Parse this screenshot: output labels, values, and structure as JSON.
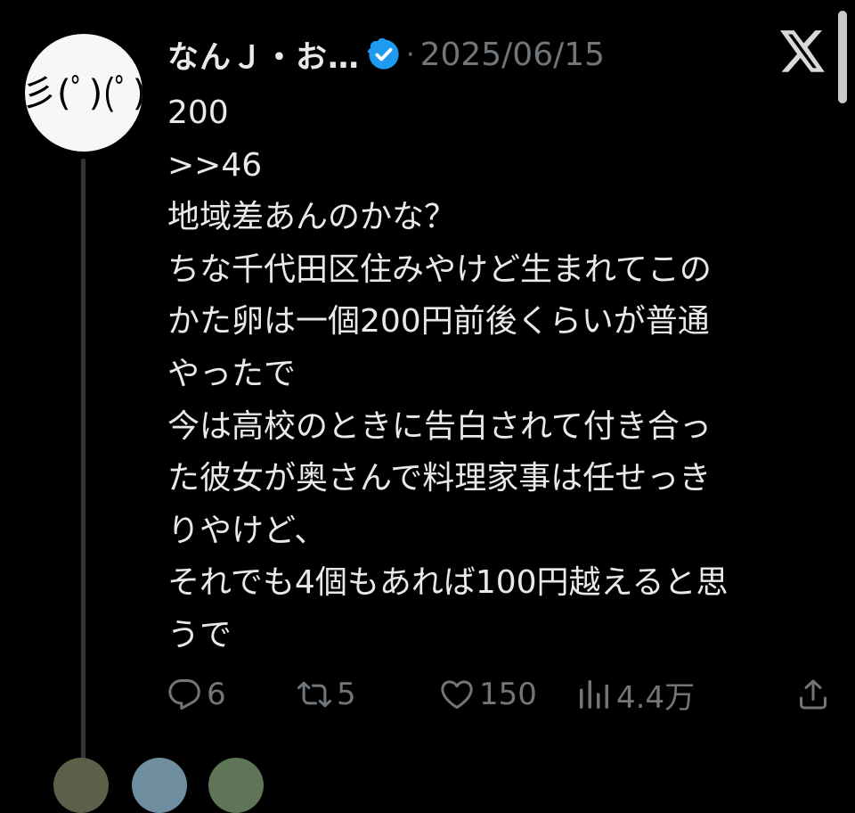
{
  "tweet": {
    "author_name": "なんＪ・お…",
    "separator": "·",
    "date": "2025/06/15",
    "avatar_text": "彡(ﾟ)(ﾟ)",
    "body_lines": [
      "200",
      ">>46",
      "地域差あんのかな？",
      "ちな千代田区住みやけど生まれてこの",
      "かた卵は一個200円前後くらいが普通",
      "やったで",
      "今は高校のときに告白されて付き合っ",
      "た彼女が奥さんで料理家事は任せっき",
      "りやけど、",
      "それでも4個もあれば100円越えると思",
      "うで"
    ],
    "actions": {
      "replies": "6",
      "reposts": "5",
      "likes": "150",
      "views": "4.4万"
    }
  },
  "icons": {
    "verified": "verified-badge-icon",
    "x_logo": "x-logo-icon",
    "reply": "reply-icon",
    "repost": "repost-icon",
    "like": "heart-icon",
    "views": "views-chart-icon",
    "share": "share-icon"
  },
  "colors": {
    "background": "#000000",
    "text": "#e7e9ea",
    "secondary": "#71767b",
    "verified": "#1d9bf0"
  }
}
